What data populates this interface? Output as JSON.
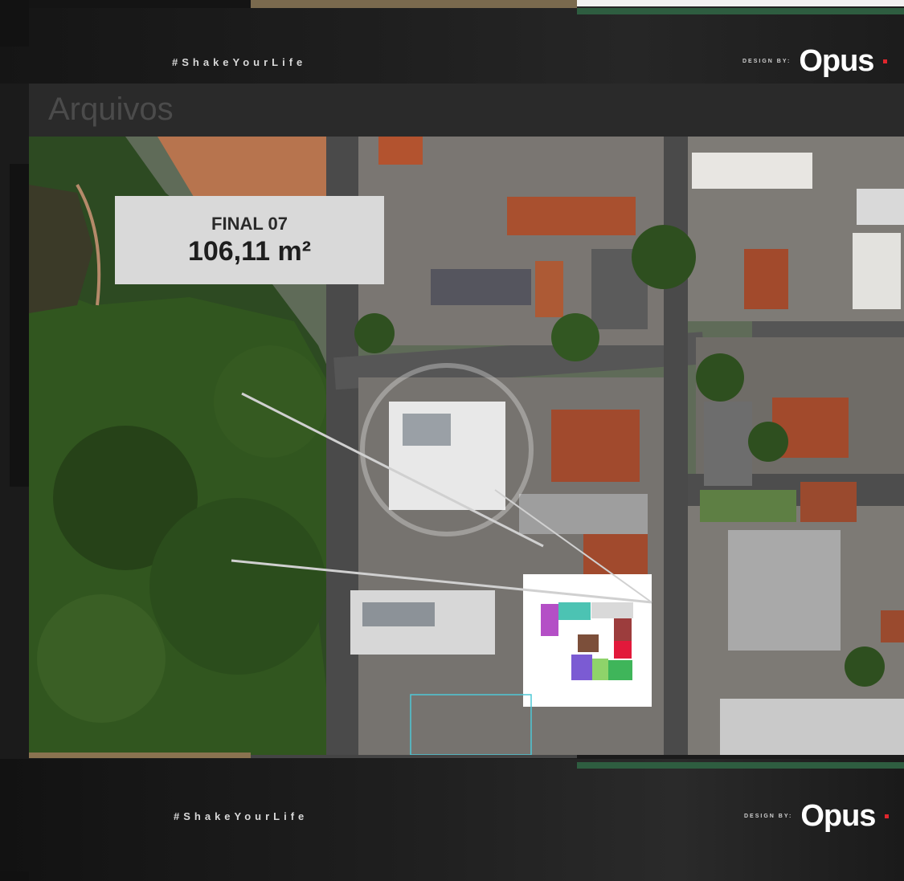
{
  "header": {
    "hashtag": "#ShakeYourLife",
    "design_by": "DESIGN BY:",
    "brand": "Opus"
  },
  "background_title": "Arquivos",
  "unit_label": {
    "title": "FINAL 07",
    "area": "106,11 m²"
  },
  "footer": {
    "hashtag": "#ShakeYourLife",
    "design_by": "DESIGN BY:",
    "brand": "Opus"
  },
  "colors": {
    "accent_green": "#2e5d40",
    "accent_gold": "#8a7350",
    "brand_red": "#e0262d"
  }
}
